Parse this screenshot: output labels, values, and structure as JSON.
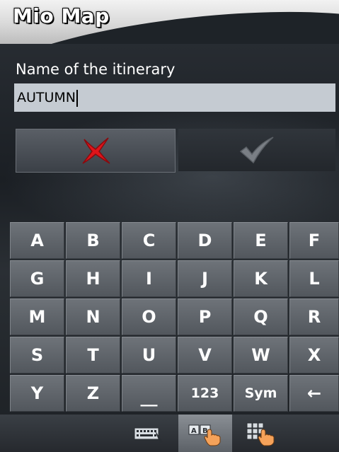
{
  "header": {
    "title": "Mio Map"
  },
  "form": {
    "label": "Name of the itinerary",
    "value": "AUTUMN"
  },
  "actions": {
    "cancel_icon": "cancel-x-icon",
    "confirm_icon": "checkmark-icon",
    "confirm_enabled": false
  },
  "keyboard": {
    "rows": [
      [
        "A",
        "B",
        "C",
        "D",
        "E",
        "F"
      ],
      [
        "G",
        "H",
        "I",
        "J",
        "K",
        "L"
      ],
      [
        "M",
        "N",
        "O",
        "P",
        "Q",
        "R"
      ],
      [
        "S",
        "T",
        "U",
        "V",
        "W",
        "X"
      ],
      [
        "Y",
        "Z",
        "__",
        "123",
        "Sym",
        "←"
      ]
    ]
  },
  "modes": [
    {
      "icon": "keyboard-icon",
      "active": false
    },
    {
      "icon": "ab-touch-icon",
      "active": true
    },
    {
      "icon": "keypad-touch-icon",
      "active": false
    }
  ],
  "colors": {
    "cancel_red": "#e0141a",
    "confirm_gray": "#7a7f85",
    "input_bg": "#c5cbd2"
  }
}
